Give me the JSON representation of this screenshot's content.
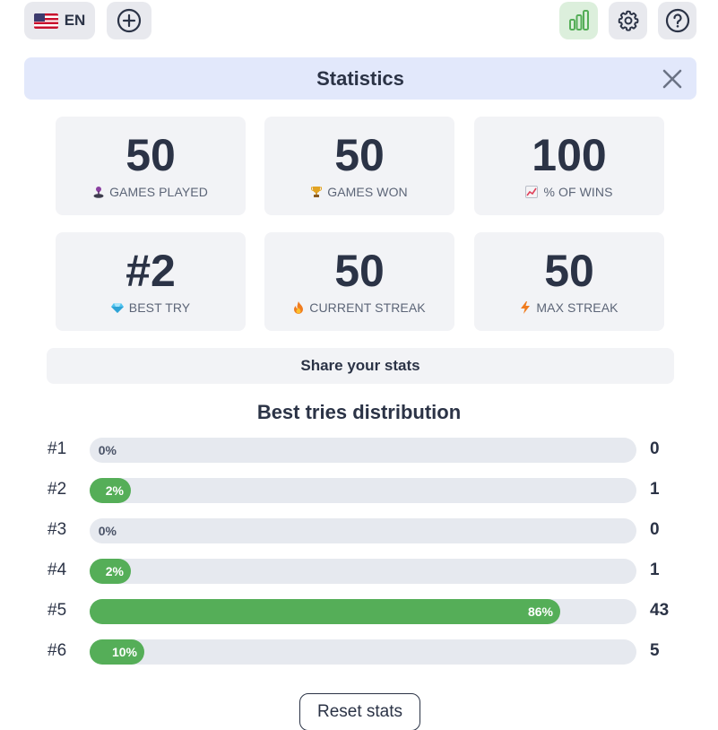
{
  "topbar": {
    "language_code": "EN",
    "flag_icon": "us-flag-icon",
    "add_icon": "plus-circle-icon",
    "stats_icon": "bar-chart-icon",
    "settings_icon": "gear-icon",
    "help_icon": "question-circle-icon",
    "active_color": "#55ae58"
  },
  "header": {
    "title": "Statistics",
    "close_icon": "close-icon"
  },
  "stats": [
    {
      "value": "50",
      "label": "GAMES PLAYED",
      "icon": "joystick-icon"
    },
    {
      "value": "50",
      "label": "GAMES WON",
      "icon": "trophy-icon"
    },
    {
      "value": "100",
      "label": "% OF WINS",
      "icon": "chart-increasing-icon"
    },
    {
      "value": "#2",
      "label": "BEST TRY",
      "icon": "gem-icon"
    },
    {
      "value": "50",
      "label": "CURRENT STREAK",
      "icon": "fire-icon"
    },
    {
      "value": "50",
      "label": "MAX STREAK",
      "icon": "lightning-icon"
    }
  ],
  "share_label": "Share your stats",
  "distribution": {
    "title": "Best tries distribution",
    "bar_color": "#55ae58",
    "rows": [
      {
        "label": "#1",
        "percent_text": "0%",
        "percent": 0,
        "count": "0"
      },
      {
        "label": "#2",
        "percent_text": "2%",
        "percent": 2,
        "count": "1"
      },
      {
        "label": "#3",
        "percent_text": "0%",
        "percent": 0,
        "count": "0"
      },
      {
        "label": "#4",
        "percent_text": "2%",
        "percent": 2,
        "count": "1"
      },
      {
        "label": "#5",
        "percent_text": "86%",
        "percent": 86,
        "count": "43"
      },
      {
        "label": "#6",
        "percent_text": "10%",
        "percent": 10,
        "count": "5"
      }
    ]
  },
  "reset_label": "Reset stats"
}
